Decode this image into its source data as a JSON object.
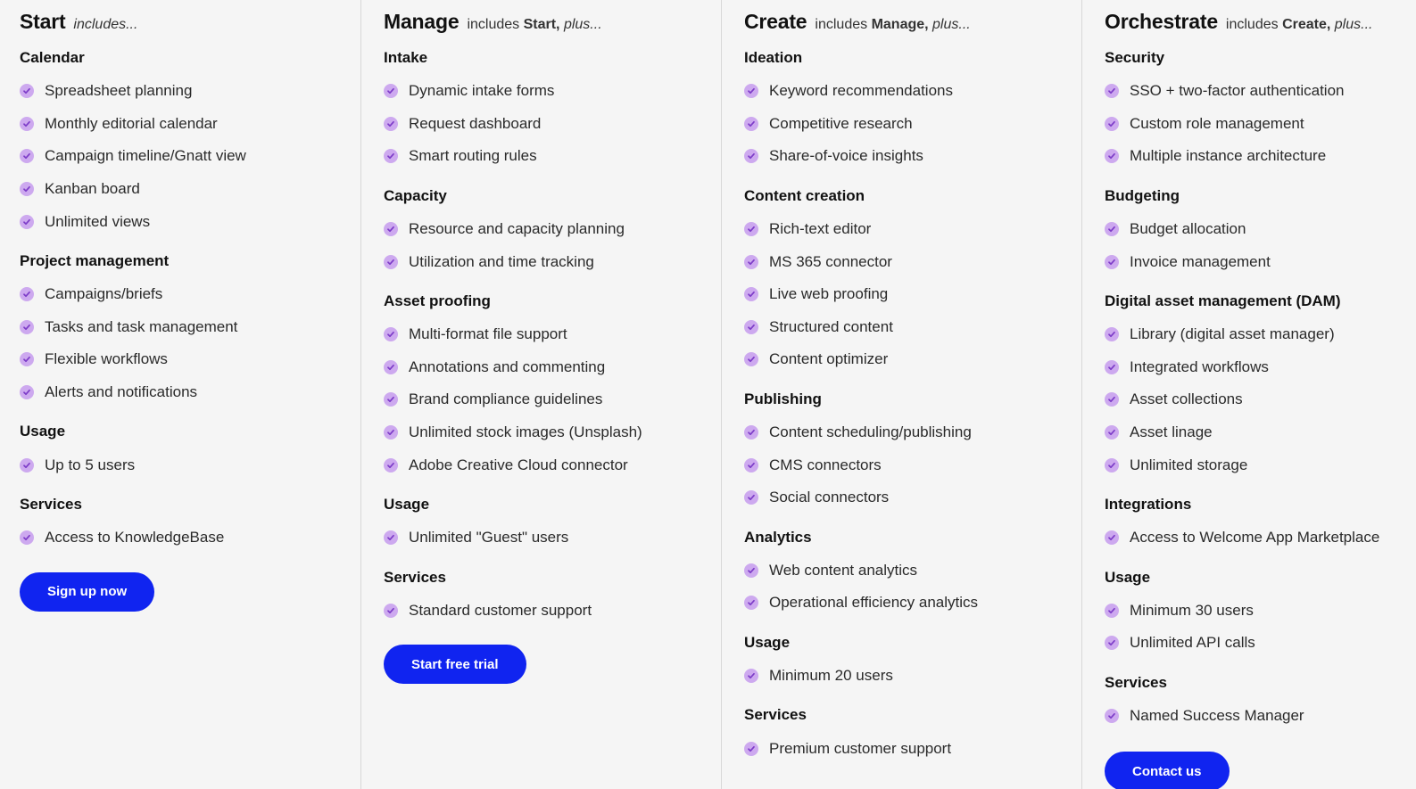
{
  "plans": [
    {
      "name": "Start",
      "subtitle_prefix": "includes...",
      "subtitle_bold": "",
      "subtitle_suffix": "",
      "sections": [
        {
          "title": "Calendar",
          "items": [
            "Spreadsheet planning",
            "Monthly editorial calendar",
            "Campaign timeline/Gnatt view",
            "Kanban board",
            "Unlimited views"
          ]
        },
        {
          "title": "Project management",
          "items": [
            "Campaigns/briefs",
            "Tasks and task management",
            "Flexible workflows",
            "Alerts and notifications"
          ]
        },
        {
          "title": "Usage",
          "items": [
            "Up to 5 users"
          ]
        },
        {
          "title": "Services",
          "items": [
            "Access to KnowledgeBase"
          ]
        }
      ],
      "cta": "Sign up now"
    },
    {
      "name": "Manage",
      "subtitle_prefix": "includes",
      "subtitle_bold": "Start,",
      "subtitle_suffix": "plus...",
      "sections": [
        {
          "title": "Intake",
          "items": [
            "Dynamic intake forms",
            "Request dashboard",
            "Smart routing rules"
          ]
        },
        {
          "title": "Capacity",
          "items": [
            "Resource and capacity planning",
            "Utilization and time tracking"
          ]
        },
        {
          "title": "Asset proofing",
          "items": [
            "Multi-format file support",
            "Annotations and commenting",
            "Brand compliance guidelines",
            "Unlimited stock images (Unsplash)",
            "Adobe Creative Cloud connector"
          ]
        },
        {
          "title": "Usage",
          "items": [
            "Unlimited \"Guest\" users"
          ]
        },
        {
          "title": "Services",
          "items": [
            "Standard customer support"
          ]
        }
      ],
      "cta": "Start free trial"
    },
    {
      "name": "Create",
      "subtitle_prefix": "includes",
      "subtitle_bold": "Manage,",
      "subtitle_suffix": "plus...",
      "sections": [
        {
          "title": "Ideation",
          "items": [
            "Keyword recommendations",
            "Competitive research",
            "Share-of-voice insights"
          ]
        },
        {
          "title": "Content creation",
          "items": [
            "Rich-text editor",
            "MS 365 connector",
            "Live web proofing",
            "Structured content",
            "Content optimizer"
          ]
        },
        {
          "title": "Publishing",
          "items": [
            "Content scheduling/publishing",
            "CMS connectors",
            "Social connectors"
          ]
        },
        {
          "title": "Analytics",
          "items": [
            "Web content analytics",
            "Operational efficiency analytics"
          ]
        },
        {
          "title": "Usage",
          "items": [
            "Minimum 20 users"
          ]
        },
        {
          "title": "Services",
          "items": [
            "Premium customer support"
          ]
        }
      ],
      "cta": ""
    },
    {
      "name": "Orchestrate",
      "subtitle_prefix": "includes",
      "subtitle_bold": "Create,",
      "subtitle_suffix": "plus...",
      "sections": [
        {
          "title": "Security",
          "items": [
            "SSO + two-factor authentication",
            "Custom role management",
            "Multiple instance architecture"
          ]
        },
        {
          "title": "Budgeting",
          "items": [
            "Budget allocation",
            "Invoice management"
          ]
        },
        {
          "title": "Digital asset management (DAM)",
          "items": [
            "Library (digital asset manager)",
            "Integrated workflows",
            "Asset collections",
            "Asset linage",
            "Unlimited storage"
          ]
        },
        {
          "title": "Integrations",
          "items": [
            "Access to Welcome App Marketplace"
          ]
        },
        {
          "title": "Usage",
          "items": [
            "Minimum 30 users",
            "Unlimited API calls"
          ]
        },
        {
          "title": "Services",
          "items": [
            "Named Success Manager"
          ]
        }
      ],
      "cta": "Contact us"
    }
  ],
  "colors": {
    "background": "#f5f5f5",
    "check_circle": "#cda9ef",
    "check_mark": "#7d3cc8",
    "cta": "#1024f0",
    "divider": "#d8d8d8"
  },
  "icons": {
    "feature_check": "checkmark-circle-icon"
  }
}
